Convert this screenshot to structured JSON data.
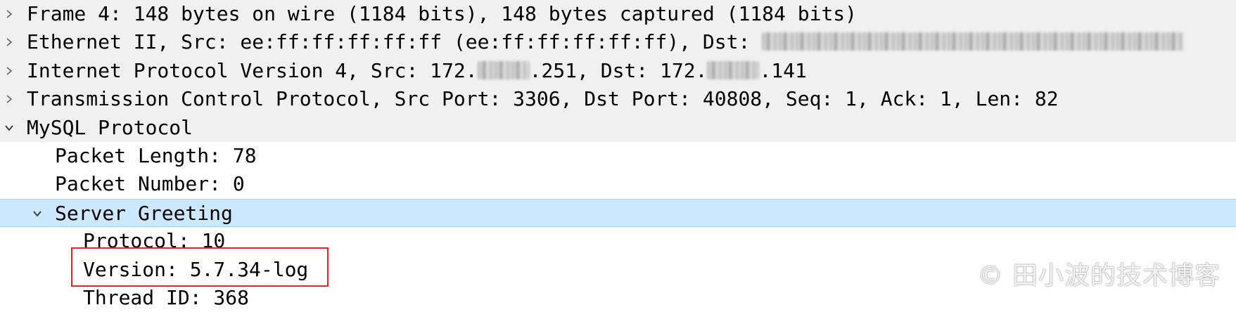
{
  "tree": {
    "frame": {
      "label": "Frame 4: 148 bytes on wire (1184 bits), 148 bytes captured (1184 bits)",
      "expanded": false
    },
    "ethernet": {
      "label_prefix": "Ethernet II, Src: ee:ff:ff:ff:ff:ff (ee:ff:ff:ff:ff:ff), Dst: ",
      "expanded": false
    },
    "ip": {
      "label_a": "Internet Protocol Version 4, Src: 172.",
      "label_b": ".251, Dst: 172.",
      "label_c": ".141",
      "expanded": false
    },
    "tcp": {
      "label": "Transmission Control Protocol, Src Port: 3306, Dst Port: 40808, Seq: 1, Ack: 1, Len: 82",
      "expanded": false
    },
    "mysql": {
      "label": "MySQL Protocol",
      "expanded": true,
      "packet_length": "Packet Length: 78",
      "packet_number": "Packet Number: 0",
      "server_greeting": {
        "label": "Server Greeting",
        "expanded": true,
        "protocol": "Protocol: 10",
        "version": "Version: 5.7.34-log",
        "thread_id": "Thread ID: 368"
      }
    }
  },
  "watermark": "© 田小波的技术博客",
  "colors": {
    "selected_row": "#cce8ff",
    "header_row": "#f0f0f0",
    "highlight_border": "#e0242b"
  },
  "icons": {
    "collapsed": "chevron-right-icon",
    "expanded": "chevron-down-icon"
  }
}
